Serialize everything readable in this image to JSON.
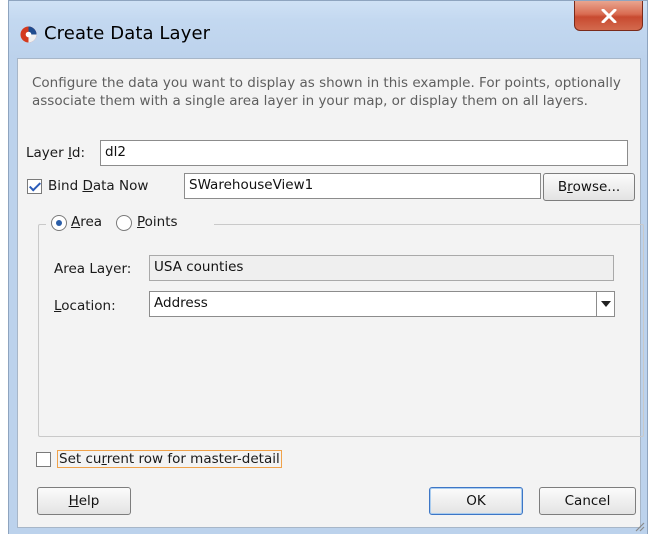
{
  "window": {
    "title": "Create Data Layer"
  },
  "description": "Configure the data you want to display as shown in this example. For points, optionally associate them with a single area layer in your map, or display them on all layers.",
  "layer_id": {
    "label_pre": "Layer ",
    "label_mnemonic": "I",
    "label_post": "d:",
    "value": "dl2"
  },
  "bind_data": {
    "checked": true,
    "label_pre": "Bind ",
    "label_mnemonic": "D",
    "label_post": "ata Now",
    "value": "SWarehouseView1",
    "browse_pre": "B",
    "browse_mnemonic": "r",
    "browse_post": "owse..."
  },
  "layer_type": {
    "area_mnemonic": "A",
    "area_rest": "rea",
    "points_mnemonic": "P",
    "points_rest": "oints",
    "selected": "Area"
  },
  "area_layer": {
    "label": "Area Layer:",
    "value": "USA counties"
  },
  "location": {
    "label_mnemonic": "L",
    "label_rest": "ocation:",
    "value": "Address"
  },
  "master_detail": {
    "checked": false,
    "label_pre": "Set cu",
    "label_mnemonic": "r",
    "label_post": "rent row for master-detail"
  },
  "buttons": {
    "help_mnemonic": "H",
    "help_rest": "elp",
    "ok": "OK",
    "cancel": "Cancel"
  },
  "colors": {
    "title_gradient_top": "#cfe1f5",
    "close_red": "#c84a30",
    "focus_orange": "#f0a24a",
    "check_blue": "#2a5bb8"
  },
  "icons": {
    "app": "oracle-jdeveloper-logo-icon",
    "close": "close-x-icon",
    "dropdown": "chevron-down-icon",
    "grip": "resize-grip-icon"
  }
}
